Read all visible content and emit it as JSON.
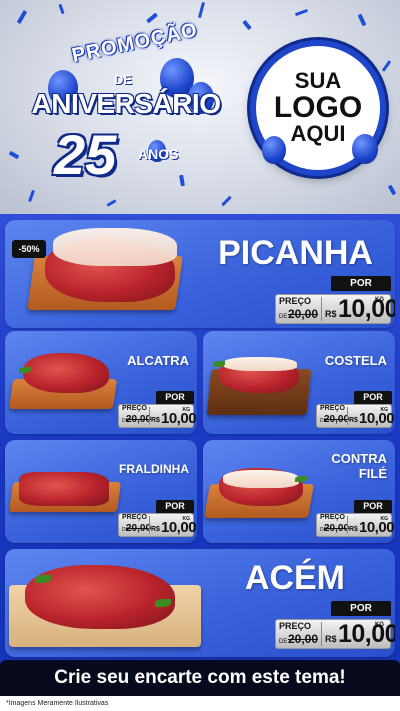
{
  "header": {
    "promo_word": "PROMOÇÃO",
    "promo_de": "DE",
    "promo_title": "ANIVERSÁRIO",
    "promo_number": "25",
    "promo_anos": "ANOS",
    "logo_lines": [
      "SUA",
      "LOGO",
      "AQUI"
    ]
  },
  "products": {
    "picanha": {
      "name": "PICANHA",
      "discount": "-50%",
      "por_label": "POR",
      "preco_label": "PREÇO",
      "de_label": "DE",
      "old_price": "20,00",
      "currency": "R$",
      "price": "10,00",
      "unit": "KG"
    },
    "alcatra": {
      "name": "ALCATRA",
      "por_label": "POR",
      "preco_label": "PREÇO",
      "de_label": "DE",
      "old_price": "20,00",
      "currency": "R$",
      "price": "10,00",
      "unit": "KG"
    },
    "costela": {
      "name": "COSTELA",
      "por_label": "POR",
      "preco_label": "PREÇO",
      "de_label": "DE",
      "old_price": "20,00",
      "currency": "R$",
      "price": "10,00",
      "unit": "KG"
    },
    "fraldinha": {
      "name": "FRALDINHA",
      "por_label": "POR",
      "preco_label": "PREÇO",
      "de_label": "DE",
      "old_price": "20,00",
      "currency": "R$",
      "price": "10,00",
      "unit": "KG"
    },
    "contrafile": {
      "name_line1": "CONTRA",
      "name_line2": "FILÉ",
      "por_label": "POR",
      "preco_label": "PREÇO",
      "de_label": "DE",
      "old_price": "20,00",
      "currency": "R$",
      "price": "10,00",
      "unit": "KG"
    },
    "acem": {
      "name": "ACÉM",
      "por_label": "POR",
      "preco_label": "PREÇO",
      "de_label": "DE",
      "old_price": "20,00",
      "currency": "R$",
      "price": "10,00",
      "unit": "KG"
    }
  },
  "cta": {
    "text": "Crie seu encarte com este tema!"
  },
  "footer": {
    "note": "*Imagens Meramente Ilustrativas"
  },
  "colors": {
    "brand_blue": "#1c3fc4",
    "card_blue": "#3a63dc",
    "cta_bg": "#060a1c",
    "tag_dark": "#111111"
  }
}
